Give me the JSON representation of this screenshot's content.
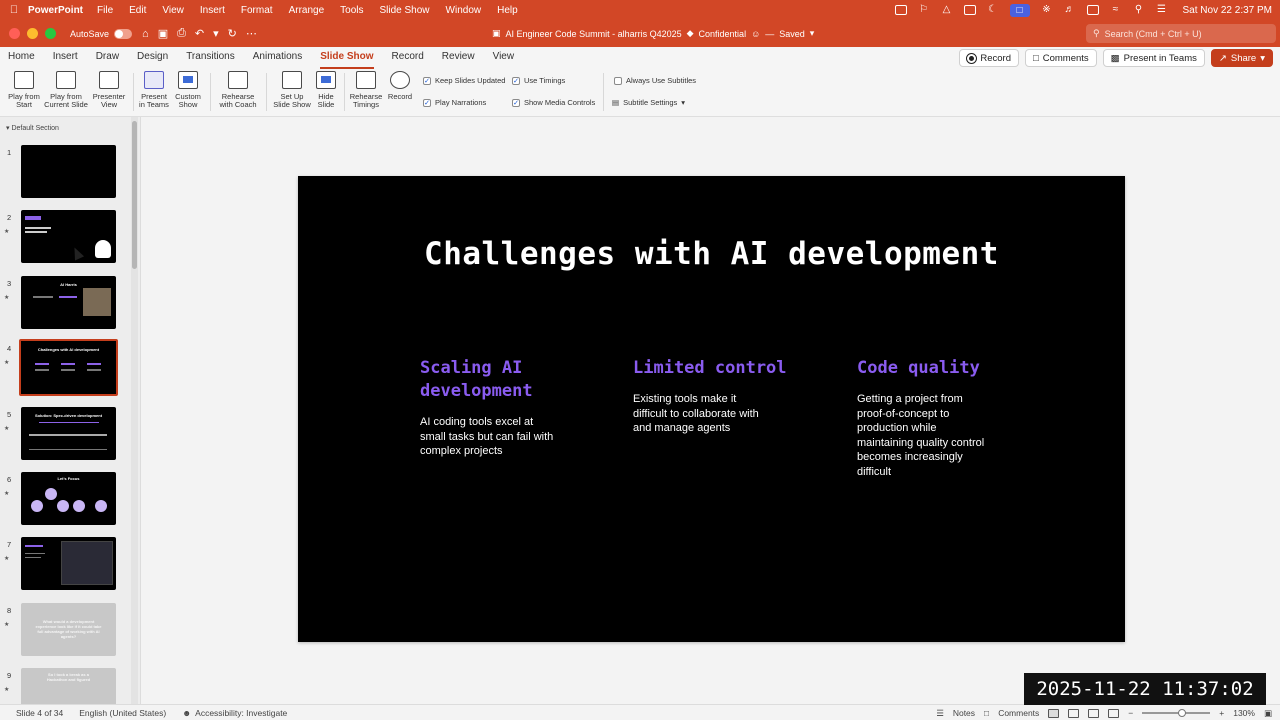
{
  "menubar": {
    "app": "PowerPoint",
    "items": [
      "File",
      "Edit",
      "View",
      "Insert",
      "Format",
      "Arrange",
      "Tools",
      "Slide Show",
      "Window",
      "Help"
    ],
    "clock": "Sat Nov 22  2:37 PM"
  },
  "titlebar": {
    "autosave": "AutoSave",
    "doc_title": "AI Engineer Code Summit - alharris Q42025",
    "sensitivity": "Confidential",
    "saved": "Saved",
    "search_placeholder": "Search (Cmd + Ctrl + U)"
  },
  "tabs": {
    "items": [
      "Home",
      "Insert",
      "Draw",
      "Design",
      "Transitions",
      "Animations",
      "Slide Show",
      "Record",
      "Review",
      "View"
    ],
    "active": "Slide Show",
    "record": "Record",
    "comments": "Comments",
    "present_teams": "Present in Teams",
    "share": "Share"
  },
  "ribbon": {
    "play_start": "Play from Start",
    "play_current": "Play from Current Slide",
    "presenter_view": "Presenter View",
    "present_teams": "Present in Teams",
    "custom_show": "Custom Show",
    "rehearse_coach": "Rehearse with Coach",
    "setup_show": "Set Up Slide Show",
    "hide_slide": "Hide Slide",
    "rehearse_timings": "Rehearse Timings",
    "record": "Record",
    "keep_slides_updated": "Keep Slides Updated",
    "use_timings": "Use Timings",
    "play_narrations": "Play Narrations",
    "show_media_controls": "Show Media Controls",
    "always_use_subtitles": "Always Use Subtitles",
    "subtitle_settings": "Subtitle Settings"
  },
  "thumbnails": {
    "section": "Default Section",
    "slides": [
      {
        "num": "1",
        "title": ""
      },
      {
        "num": "2",
        "title": ""
      },
      {
        "num": "3",
        "title": "Al Harris"
      },
      {
        "num": "4",
        "title": "Challenges with AI development"
      },
      {
        "num": "5",
        "title": "Solution: Spec-driven development"
      },
      {
        "num": "6",
        "title": "Let's Focus"
      },
      {
        "num": "7",
        "title": ""
      },
      {
        "num": "8",
        "title": "What would a development experience look like if it could take full advantage of working with AI agents?"
      },
      {
        "num": "9",
        "title": "So I took a break as a Hackathon and figured"
      }
    ]
  },
  "slide": {
    "title": "Challenges with AI development",
    "columns": [
      {
        "heading": "Scaling AI development",
        "body": "AI coding tools excel at small tasks but can fail with complex projects"
      },
      {
        "heading": "Limited control",
        "body": "Existing tools make it difficult to collaborate with and manage agents"
      },
      {
        "heading": "Code quality",
        "body": "Getting a project from proof-of-concept to production while maintaining quality control becomes increasingly difficult"
      }
    ]
  },
  "status": {
    "slide_of": "Slide 4 of 34",
    "language": "English (United States)",
    "accessibility": "Accessibility: Investigate",
    "notes": "Notes",
    "comments": "Comments",
    "zoom": "130%",
    "zoom_level": 0.6
  },
  "overlay": {
    "timestamp": "2025-11-22 11:37:02"
  }
}
